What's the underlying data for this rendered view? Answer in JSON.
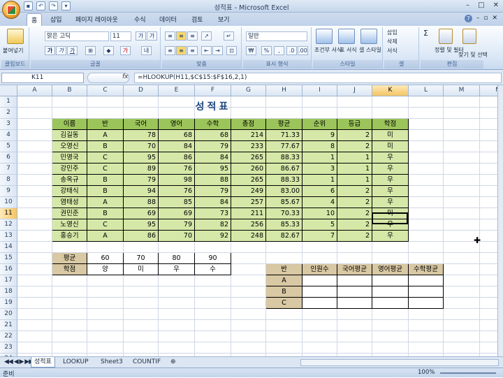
{
  "window": {
    "title": "성적표 - Microsoft Excel"
  },
  "ribbon_tabs": [
    "홈",
    "삽입",
    "페이지 레이아웃",
    "수식",
    "데이터",
    "검토",
    "보기"
  ],
  "ribbon": {
    "paste": "붙여넣기",
    "font_name": "맑은 고딕",
    "font_size": "11",
    "number_format": "일반",
    "groups": [
      "클립보드",
      "글꼴",
      "맞춤",
      "표시 형식",
      "스타일",
      "셀",
      "편집"
    ],
    "style_buttons": [
      "조건부 서식",
      "표 서식",
      "셀 스타일"
    ],
    "cell_buttons": [
      "삽입",
      "삭제",
      "서식"
    ],
    "edit_buttons": [
      "정렬 및 필터",
      "찾기 및 선택"
    ]
  },
  "formula_bar": {
    "name_box": "K11",
    "fx": "fx",
    "formula": "=HLOOKUP(H11,$C$15:$F$16,2,1)"
  },
  "columns": [
    "A",
    "B",
    "C",
    "D",
    "E",
    "F",
    "G",
    "H",
    "I",
    "J",
    "K",
    "L",
    "M",
    "N"
  ],
  "rows": [
    "1",
    "2",
    "3",
    "4",
    "5",
    "6",
    "7",
    "8",
    "9",
    "10",
    "11",
    "12",
    "13",
    "14",
    "15",
    "16",
    "17",
    "18",
    "19",
    "20",
    "21",
    "22",
    "23",
    "24"
  ],
  "sheet_title": "성적표",
  "table_headers": [
    "이름",
    "반",
    "국어",
    "영어",
    "수학",
    "총점",
    "평균",
    "순위",
    "등급",
    "학점"
  ],
  "students": [
    [
      "김길동",
      "A",
      "78",
      "68",
      "68",
      "214",
      "71.33",
      "9",
      "2",
      "미"
    ],
    [
      "오영신",
      "B",
      "70",
      "84",
      "79",
      "233",
      "77.67",
      "8",
      "2",
      "미"
    ],
    [
      "민영국",
      "C",
      "95",
      "86",
      "84",
      "265",
      "88.33",
      "1",
      "1",
      "우"
    ],
    [
      "강민주",
      "C",
      "89",
      "76",
      "95",
      "260",
      "86.67",
      "3",
      "1",
      "우"
    ],
    [
      "송옥규",
      "B",
      "79",
      "98",
      "88",
      "265",
      "88.33",
      "1",
      "1",
      "우"
    ],
    [
      "강태식",
      "B",
      "94",
      "76",
      "79",
      "249",
      "83.00",
      "6",
      "2",
      "우"
    ],
    [
      "염태성",
      "A",
      "88",
      "85",
      "84",
      "257",
      "85.67",
      "4",
      "2",
      "우"
    ],
    [
      "권민준",
      "B",
      "69",
      "69",
      "73",
      "211",
      "70.33",
      "10",
      "2",
      "미"
    ],
    [
      "노영신",
      "C",
      "95",
      "79",
      "82",
      "256",
      "85.33",
      "5",
      "2",
      "우"
    ],
    [
      "홍승기",
      "A",
      "86",
      "70",
      "92",
      "248",
      "82.67",
      "7",
      "2",
      "우"
    ]
  ],
  "lookup": {
    "label1": "평균",
    "label2": "학점",
    "scores": [
      "60",
      "70",
      "80",
      "90"
    ],
    "grades": [
      "양",
      "미",
      "우",
      "수"
    ]
  },
  "summary": {
    "headers": [
      "반",
      "인원수",
      "국어평균",
      "영어평균",
      "수학평균"
    ],
    "classes": [
      "A",
      "B",
      "C"
    ]
  },
  "sheets": [
    "성적표",
    "LOOKUP",
    "Sheet3",
    "COUNTIF"
  ],
  "status": {
    "ready": "준비",
    "zoom": "100%"
  }
}
